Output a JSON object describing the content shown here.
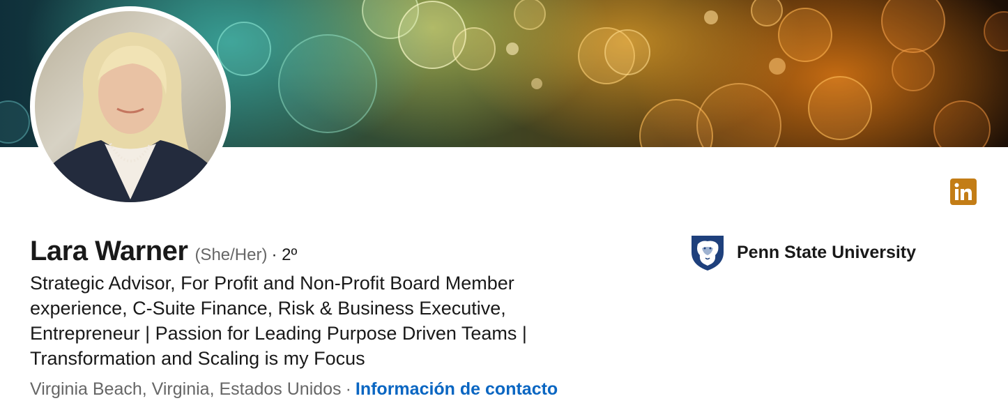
{
  "profile": {
    "name": "Lara Warner",
    "pronouns": "(She/Her)",
    "degree": "· 2º",
    "headline": "Strategic Advisor, For Profit and Non-Profit Board Member experience, C-Suite Finance, Risk & Business Executive, Entrepreneur | Passion for Leading Purpose Driven Teams | Transformation and Scaling is my Focus",
    "location": "Virginia Beach, Virginia, Estados Unidos",
    "separator": "·",
    "contact_link": "Información de contacto"
  },
  "education": {
    "school": "Penn State University",
    "logo_icon": "penn-state-shield-icon"
  },
  "badge": {
    "icon": "linkedin-icon",
    "text": "in",
    "color": "#c37d16"
  },
  "colors": {
    "link": "#0a66c2",
    "secondary_text": "#666666",
    "primary_text": "#191919"
  },
  "banner": {
    "icon": "bokeh-background-image"
  },
  "avatar": {
    "icon": "profile-photo"
  }
}
